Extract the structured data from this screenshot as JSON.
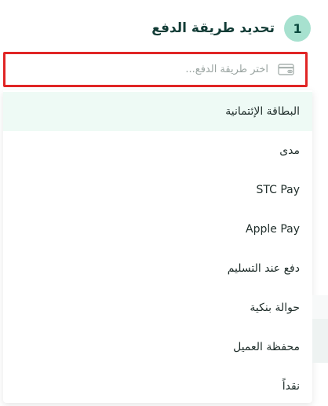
{
  "step": {
    "number": "1",
    "title": "تحديد طريقة الدفع"
  },
  "payment_select": {
    "placeholder": "اختر طريقة الدفع...",
    "icon": "credit-card-icon"
  },
  "payment_options": [
    {
      "label": "البطاقة الإئتمانية",
      "highlighted": true
    },
    {
      "label": "مدى",
      "highlighted": false
    },
    {
      "label": "STC Pay",
      "highlighted": false
    },
    {
      "label": "Apple Pay",
      "highlighted": false
    },
    {
      "label": "دفع عند التسليم",
      "highlighted": false
    },
    {
      "label": "حوالة بنكية",
      "highlighted": false
    },
    {
      "label": "محفظة العميل",
      "highlighted": false
    },
    {
      "label": "نقداً",
      "highlighted": false
    }
  ],
  "colors": {
    "step_badge": "#a7e1cf",
    "focus_outline": "#e02525",
    "highlight_row": "#eefaf5"
  }
}
